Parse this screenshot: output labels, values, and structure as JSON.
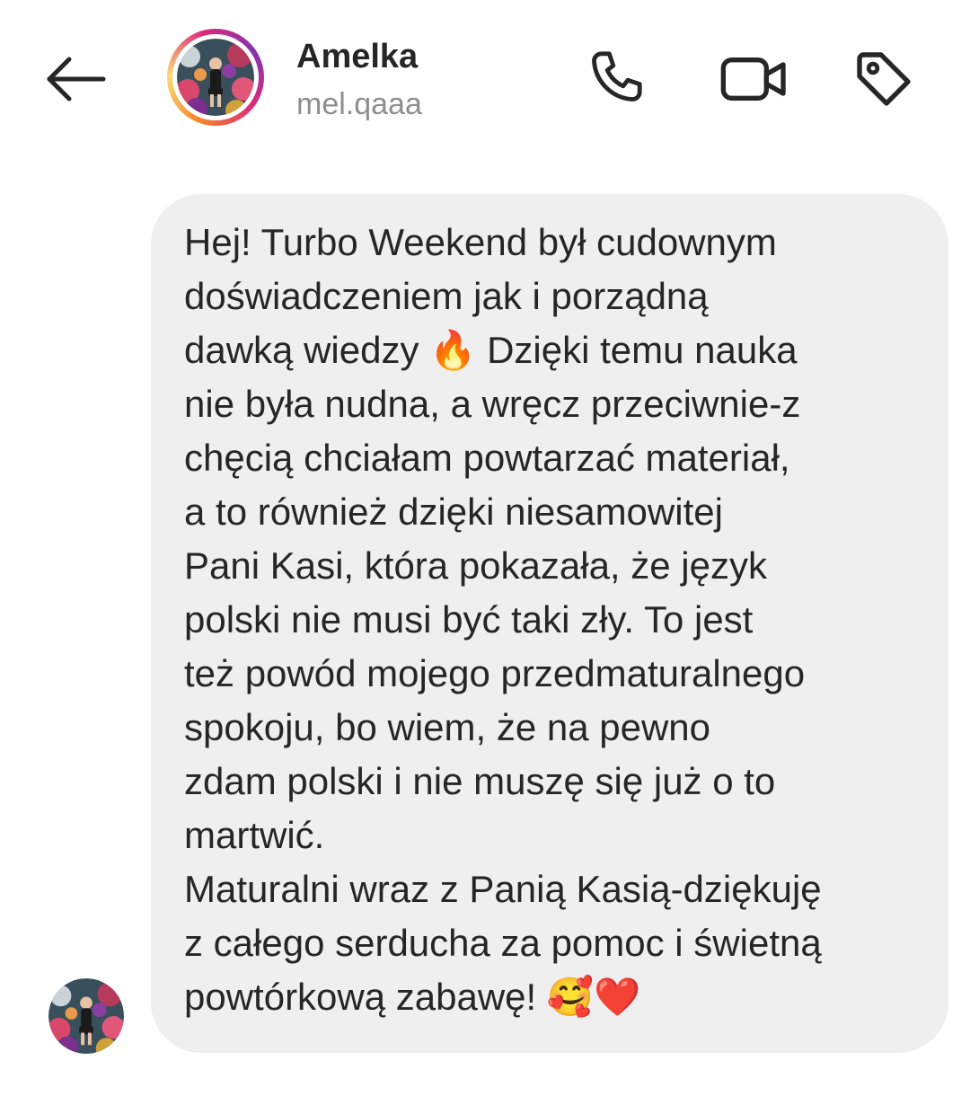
{
  "header": {
    "display_name": "Amelka",
    "username": "mel.qaaa",
    "back_icon": "arrow-left-icon",
    "call_icon": "phone-icon",
    "video_icon": "video-camera-icon",
    "tag_icon": "tag-icon"
  },
  "message": {
    "lines": [
      "Hej! Turbo Weekend był cudownym",
      "doświadczeniem jak i porządną",
      "dawką wiedzy 🔥 Dzięki temu nauka",
      "nie była nudna, a wręcz przeciwnie-z",
      "chęcią chciałam powtarzać materiał,",
      "a to również dzięki niesamowitej",
      "Pani Kasi, która pokazała, że język",
      "polski nie musi być taki zły. To jest",
      "też powód mojego przedmaturalnego",
      "spokoju, bo wiem, że na pewno",
      "zdam polski i nie muszę się już o to",
      "martwić.",
      "Maturalni wraz z Panią Kasią-dziękuję",
      "z całego serducha za pomoc i świetną",
      "powtórkową zabawę! 🥰❤️"
    ]
  },
  "colors": {
    "bubble": "#efefef",
    "text": "#262626",
    "secondary_text": "#8e8e8e",
    "story_ring": [
      "#f58529",
      "#dd2a7b",
      "#8134af"
    ]
  }
}
